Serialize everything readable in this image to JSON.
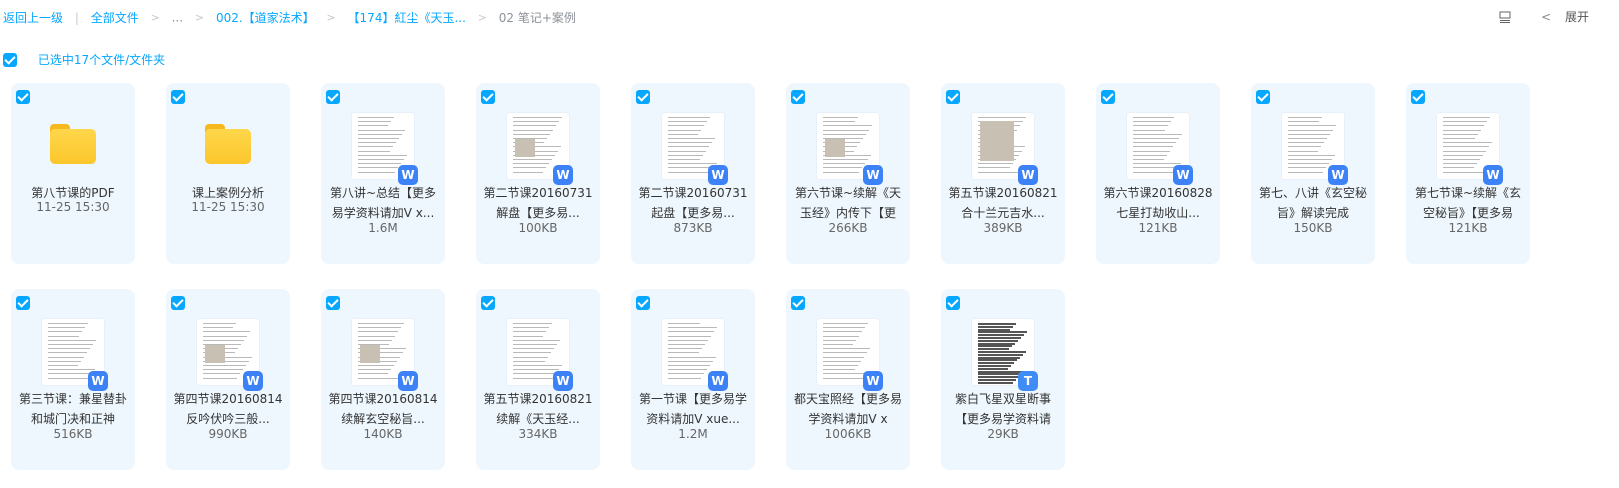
{
  "breadcrumb": {
    "back": "返回上一级",
    "sep": "|",
    "all_files": "全部文件",
    "ellipsis": "...",
    "arrow": ">",
    "c1": "002.【道家法术】",
    "c2": "【174】紅尘《天玉...",
    "current": "02 笔记+案例"
  },
  "toolbar": {
    "chevron": "<",
    "expand_label": "展开"
  },
  "selection": {
    "label": "已选中17个文件/文件夹"
  },
  "badges": {
    "word": "W",
    "text": "T"
  },
  "items": [
    {
      "type": "folder",
      "name": "第八节课的PDF",
      "meta": "11-25 15:30"
    },
    {
      "type": "folder",
      "name": "课上案例分析",
      "meta": "11-25 15:30"
    },
    {
      "type": "word",
      "name": "第八讲~总结【更多易学资料请加V x...",
      "meta": "1.6M"
    },
    {
      "type": "word",
      "name": "第二节课20160731解盘【更多易...",
      "meta": "100KB"
    },
    {
      "type": "word",
      "name": "第二节课20160731起盘【更多易...",
      "meta": "873KB"
    },
    {
      "type": "word",
      "name": "第六节课~续解《天玉经》内传下【更",
      "meta": "266KB"
    },
    {
      "type": "word",
      "name": "第五节课20160821合十兰元吉水...",
      "meta": "389KB"
    },
    {
      "type": "word",
      "name": "第六节课20160828七星打劫收山...",
      "meta": "121KB"
    },
    {
      "type": "word",
      "name": "第七、八讲《玄空秘旨》解读完成",
      "meta": "150KB"
    },
    {
      "type": "word",
      "name": "第七节课~续解《玄空秘旨》【更多易",
      "meta": "121KB"
    },
    {
      "type": "word",
      "name": "第三节课：兼星替卦和城门决和正神",
      "meta": "516KB"
    },
    {
      "type": "word",
      "name": "第四节课20160814反吟伏吟三般...",
      "meta": "990KB"
    },
    {
      "type": "word",
      "name": "第四节课20160814续解玄空秘旨...",
      "meta": "140KB"
    },
    {
      "type": "word",
      "name": "第五节课20160821续解《天玉经...",
      "meta": "334KB"
    },
    {
      "type": "word",
      "name": "第一节课【更多易学资料请加V xue...",
      "meta": "1.2M"
    },
    {
      "type": "word",
      "name": "都天宝照经【更多易学资料请加V x",
      "meta": "1006KB"
    },
    {
      "type": "text",
      "name": "紫白飞星双星断事【更多易学资料请",
      "meta": "29KB"
    }
  ]
}
